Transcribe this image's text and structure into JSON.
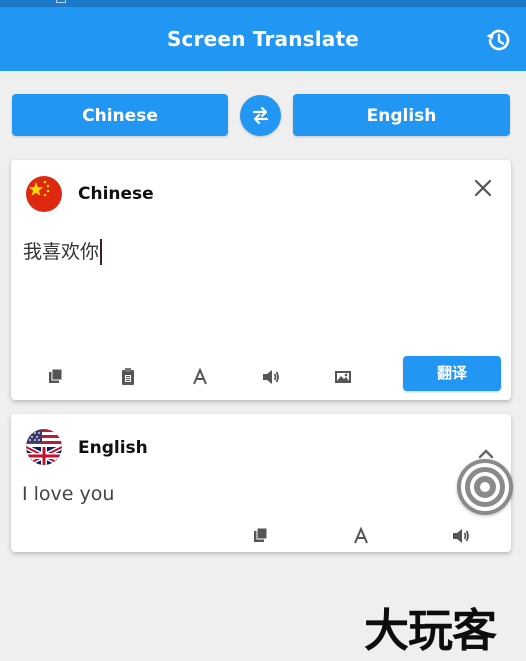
{
  "app": {
    "title": "Screen Translate"
  },
  "language_bar": {
    "source": "Chinese",
    "target": "English"
  },
  "source_card": {
    "language": "Chinese",
    "text": "我喜欢你",
    "translate_label": "翻译"
  },
  "target_card": {
    "language": "English",
    "text": "I love you"
  },
  "watermark": "大玩客",
  "icons": {
    "history": "history-icon",
    "swap": "swap-arrows-icon",
    "close": "close-icon",
    "copy": "copy-icon",
    "paste": "paste-icon",
    "font": "font-icon",
    "speaker": "speaker-icon",
    "image": "image-icon",
    "expand": "chevron-up-icon",
    "floating": "target-icon"
  },
  "colors": {
    "primary": "#2196f3",
    "background": "#efefef",
    "card": "#ffffff"
  }
}
